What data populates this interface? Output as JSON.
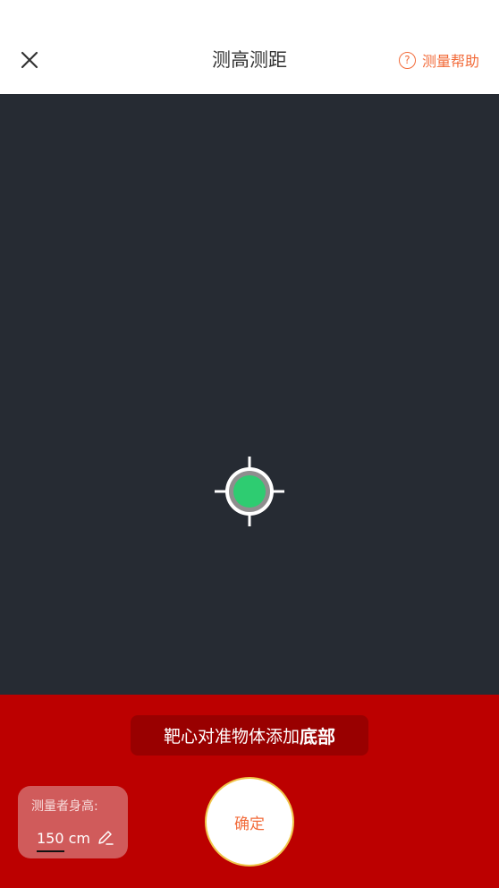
{
  "header": {
    "title": "测高测距",
    "help_label": "测量帮助",
    "close_icon": "close-icon",
    "help_icon": "question-circle-icon"
  },
  "camera": {
    "target_icon": "crosshair-target-icon"
  },
  "bottom": {
    "hint_prefix": "靶心对准物体添加",
    "hint_emphasis": "底部",
    "height_label": "测量者身高:",
    "height_value": "150 cm",
    "edit_icon": "pencil-icon",
    "confirm_label": "确定"
  },
  "colors": {
    "accent": "#f26b3a",
    "camera_bg": "#262b33",
    "bottom_bg": "#bc0000",
    "target_green": "#2ecc71"
  }
}
